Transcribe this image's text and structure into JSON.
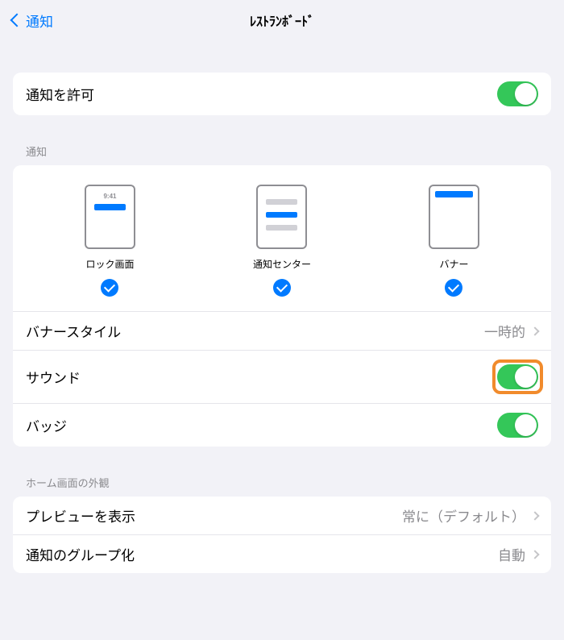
{
  "nav": {
    "back": "通知",
    "title": "ﾚｽﾄﾗﾝﾎﾞｰﾄﾞ"
  },
  "allow": {
    "label": "通知を許可"
  },
  "notifSection": {
    "header": "通知",
    "options": {
      "lock": {
        "label": "ロック画面",
        "time": "9:41"
      },
      "center": {
        "label": "通知センター"
      },
      "banner": {
        "label": "バナー"
      }
    },
    "rows": {
      "bannerStyle": {
        "label": "バナースタイル",
        "value": "一時的"
      },
      "sounds": {
        "label": "サウンド"
      },
      "badges": {
        "label": "バッジ"
      }
    }
  },
  "homeSection": {
    "header": "ホーム画面の外観",
    "rows": {
      "preview": {
        "label": "プレビューを表示",
        "value": "常に（デフォルト）"
      },
      "grouping": {
        "label": "通知のグループ化",
        "value": "自動"
      }
    }
  }
}
